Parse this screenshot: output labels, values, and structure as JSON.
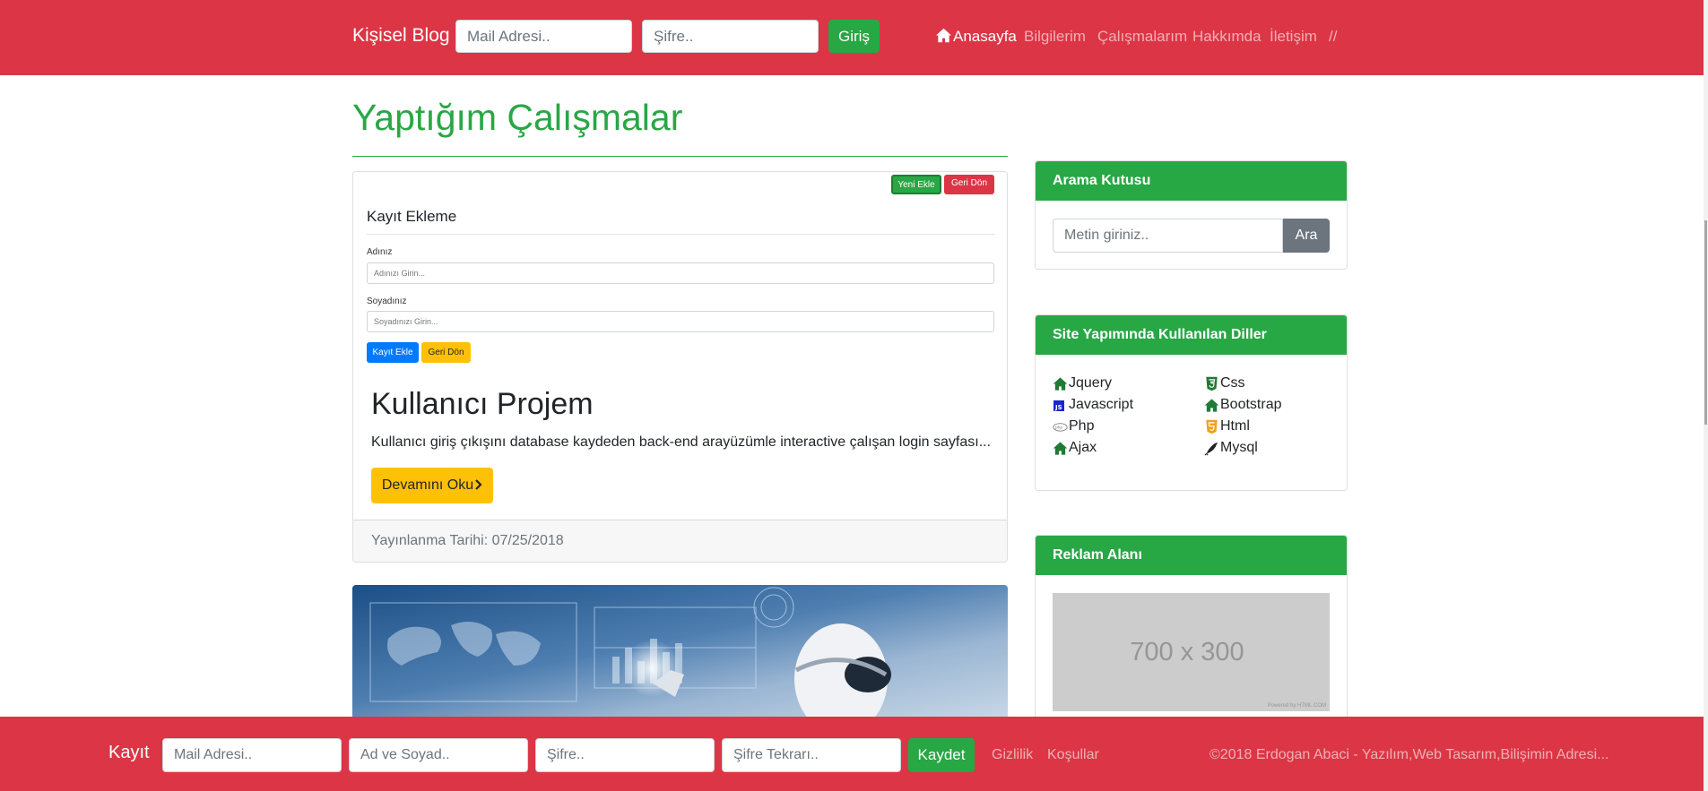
{
  "header": {
    "brand": "Kişisel Blog",
    "email_placeholder": "Mail Adresi..",
    "password_placeholder": "Şifre..",
    "login_button": "Giriş",
    "nav": [
      {
        "label": "Anasayfa",
        "icon": "home-icon",
        "active": true
      },
      {
        "label": "Bilgilerim"
      },
      {
        "label": "Çalışmalarım"
      },
      {
        "label": "Hakkımda"
      },
      {
        "label": "İletişim"
      },
      {
        "label": "//"
      }
    ]
  },
  "main": {
    "page_title": "Yaptığım Çalışmalar",
    "posts": [
      {
        "screenshot": {
          "new_button": "Yeni Ekle",
          "back_button": "Geri Dön",
          "form_title": "Kayıt Ekleme",
          "name_label": "Adınız",
          "name_placeholder": "Adınızı Girin...",
          "surname_label": "Soyadınız",
          "surname_placeholder": "Soyadınızı Girin...",
          "add_button": "Kayıt Ekle",
          "back_button2": "Geri Dön"
        },
        "title": "Kullanıcı Projem",
        "excerpt": "Kullanıcı giriş çıkışını database kaydeden back-end arayüzümle interactive çalışan login sayfası...",
        "read_more": "Devamını Oku",
        "date_label": "Yayınlanma Tarihi: 07/25/2018"
      }
    ]
  },
  "sidebar": {
    "search": {
      "title": "Arama Kutusu",
      "placeholder": "Metin giriniz..",
      "button": "Ara"
    },
    "languages": {
      "title": "Site Yapımında Kullanılan Diller",
      "items": [
        {
          "label": "Jquery",
          "icon": "home-icon"
        },
        {
          "label": "Css",
          "icon": "css3-icon"
        },
        {
          "label": "Javascript",
          "icon": "js-icon"
        },
        {
          "label": "Bootstrap",
          "icon": "home-icon"
        },
        {
          "label": "Php",
          "icon": "php-icon"
        },
        {
          "label": "Html",
          "icon": "html5-icon"
        },
        {
          "label": "Ajax",
          "icon": "home-icon"
        },
        {
          "label": "Mysql",
          "icon": "dolphin-icon"
        }
      ]
    },
    "ad": {
      "title": "Reklam Alanı",
      "placeholder_text": "700 x 300",
      "credit": "Powered by HTML.COM"
    }
  },
  "footer": {
    "brand": "Kayıt",
    "email_placeholder": "Mail Adresi..",
    "name_placeholder": "Ad ve Soyad..",
    "password_placeholder": "Şifre..",
    "password_repeat_placeholder": "Şifre Tekrarı..",
    "save_button": "Kaydet",
    "links": [
      "Gizlilik",
      "Koşullar"
    ],
    "copyright": "©2018 Erdogan Abaci - Yazılım,Web Tasarım,Bilişimin Adresi..."
  },
  "colors": {
    "primary_red": "#dc3545",
    "success_green": "#28a745",
    "warning_yellow": "#ffc107",
    "secondary_gray": "#6c757d"
  }
}
